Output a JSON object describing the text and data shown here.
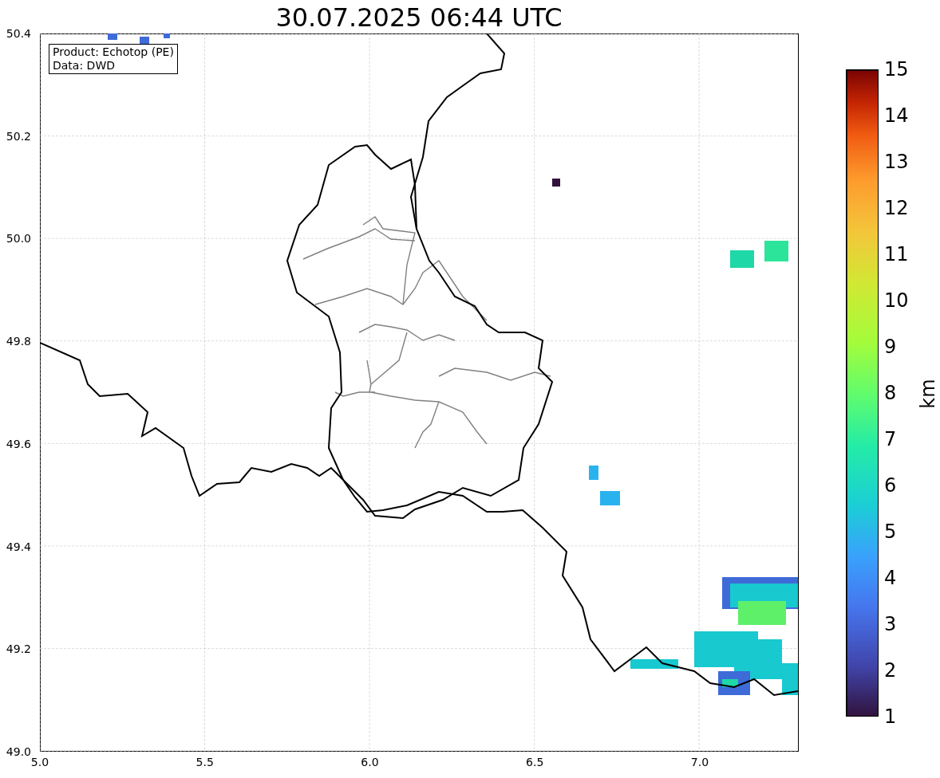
{
  "title": "30.07.2025 06:44 UTC",
  "info_box": [
    "Product: Echotop (PE)",
    "Data: DWD"
  ],
  "x_ticks": [
    "5.0",
    "5.5",
    "6.0",
    "6.5",
    "7.0"
  ],
  "y_ticks": [
    "50.4",
    "50.2",
    "50.0",
    "49.8",
    "49.6",
    "49.4",
    "49.2",
    "49.0"
  ],
  "colorbar": {
    "label": "km",
    "ticks": [
      "15",
      "14",
      "13",
      "12",
      "11",
      "10",
      "9",
      "8",
      "7",
      "6",
      "5",
      "4",
      "3",
      "2",
      "1"
    ]
  }
}
